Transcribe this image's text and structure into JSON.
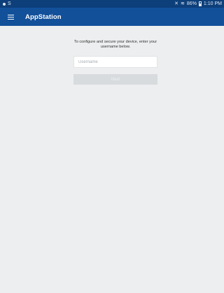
{
  "status_bar": {
    "left_icon": "S",
    "mute_icon": "mute-icon",
    "wifi_icon": "wifi-icon",
    "battery_text": "86%",
    "battery_icon": "battery-icon",
    "time": "1:10 PM"
  },
  "app_bar": {
    "menu_icon": "hamburger-menu-icon",
    "title": "AppStation",
    "background": "#12509a"
  },
  "login": {
    "prompt": "To configure and secure your device, enter your username below.",
    "username_placeholder": "Username",
    "username_value": "",
    "next_label": "Next"
  }
}
